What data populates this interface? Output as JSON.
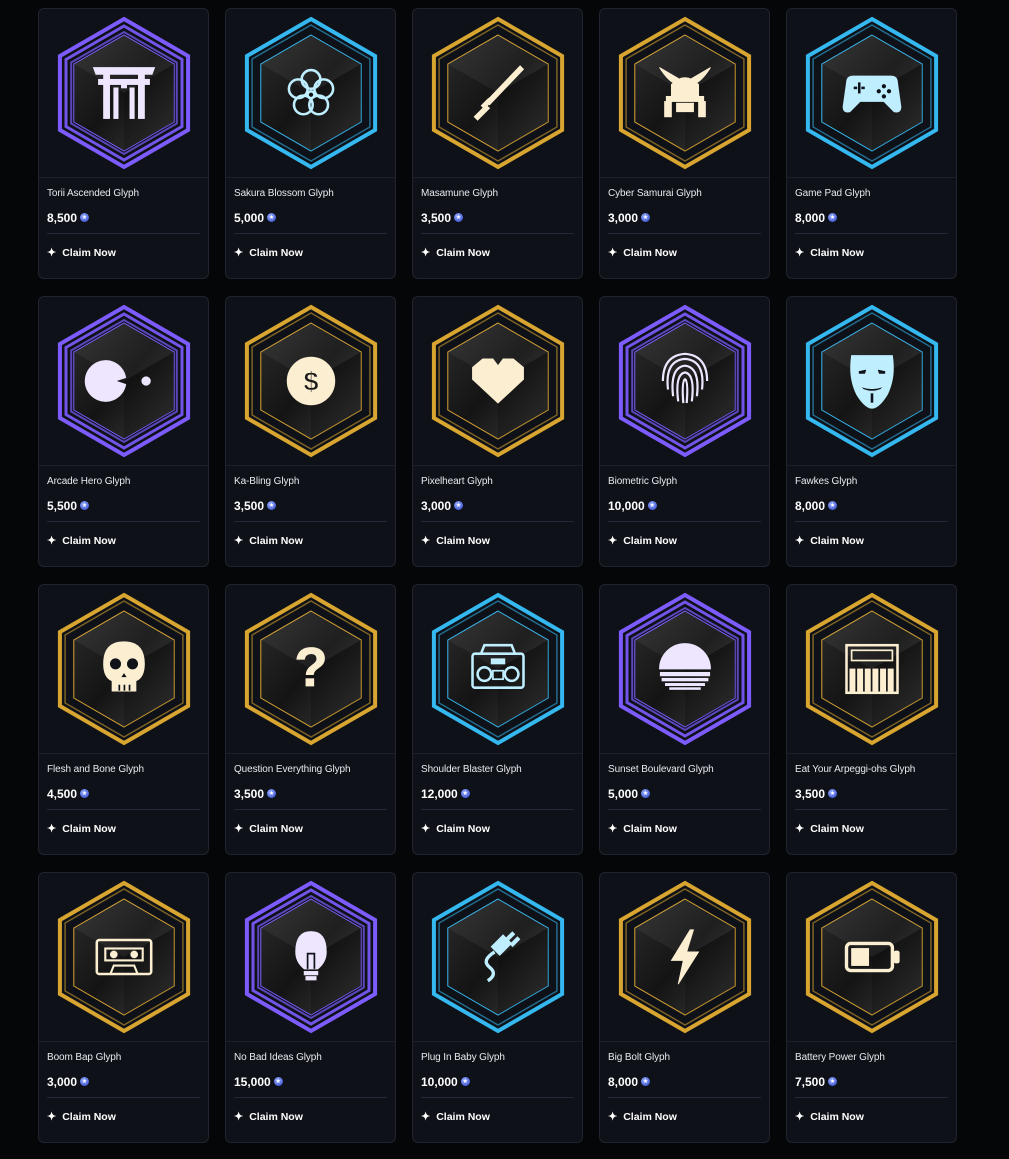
{
  "claim_label": "Claim Now",
  "currency_icon": "star-gem-icon",
  "colors": {
    "purple": "#7d5cff",
    "cyan": "#35b8f0",
    "gold": "#d9a531"
  },
  "glyphs": [
    {
      "name": "Torii Ascended Glyph",
      "price": "8,500",
      "frame": "purple",
      "icon": "torii-gate-icon"
    },
    {
      "name": "Sakura Blossom Glyph",
      "price": "5,000",
      "frame": "cyan",
      "icon": "sakura-flower-icon"
    },
    {
      "name": "Masamune Glyph",
      "price": "3,500",
      "frame": "gold",
      "icon": "katana-icon"
    },
    {
      "name": "Cyber Samurai Glyph",
      "price": "3,000",
      "frame": "gold",
      "icon": "samurai-helmet-icon"
    },
    {
      "name": "Game Pad Glyph",
      "price": "8,000",
      "frame": "cyan",
      "icon": "gamepad-icon"
    },
    {
      "name": "Arcade Hero Glyph",
      "price": "5,500",
      "frame": "purple",
      "icon": "pacman-icon"
    },
    {
      "name": "Ka-Bling Glyph",
      "price": "3,500",
      "frame": "gold",
      "icon": "dollar-coin-icon"
    },
    {
      "name": "Pixelheart Glyph",
      "price": "3,000",
      "frame": "gold",
      "icon": "pixel-heart-icon"
    },
    {
      "name": "Biometric Glyph",
      "price": "10,000",
      "frame": "purple",
      "icon": "fingerprint-icon"
    },
    {
      "name": "Fawkes Glyph",
      "price": "8,000",
      "frame": "cyan",
      "icon": "fawkes-mask-icon"
    },
    {
      "name": "Flesh and Bone Glyph",
      "price": "4,500",
      "frame": "gold",
      "icon": "skull-icon"
    },
    {
      "name": "Question Everything Glyph",
      "price": "3,500",
      "frame": "gold",
      "icon": "question-mark-icon"
    },
    {
      "name": "Shoulder Blaster Glyph",
      "price": "12,000",
      "frame": "cyan",
      "icon": "boombox-icon"
    },
    {
      "name": "Sunset Boulevard Glyph",
      "price": "5,000",
      "frame": "purple",
      "icon": "retro-sun-icon"
    },
    {
      "name": "Eat Your Arpeggi-ohs Glyph",
      "price": "3,500",
      "frame": "gold",
      "icon": "synthesizer-icon"
    },
    {
      "name": "Boom Bap Glyph",
      "price": "3,000",
      "frame": "gold",
      "icon": "cassette-tape-icon"
    },
    {
      "name": "No Bad Ideas Glyph",
      "price": "15,000",
      "frame": "purple",
      "icon": "lightbulb-icon"
    },
    {
      "name": "Plug In Baby Glyph",
      "price": "10,000",
      "frame": "cyan",
      "icon": "power-plug-icon"
    },
    {
      "name": "Big Bolt Glyph",
      "price": "8,000",
      "frame": "gold",
      "icon": "lightning-bolt-icon"
    },
    {
      "name": "Battery Power Glyph",
      "price": "7,500",
      "frame": "gold",
      "icon": "battery-icon"
    }
  ]
}
